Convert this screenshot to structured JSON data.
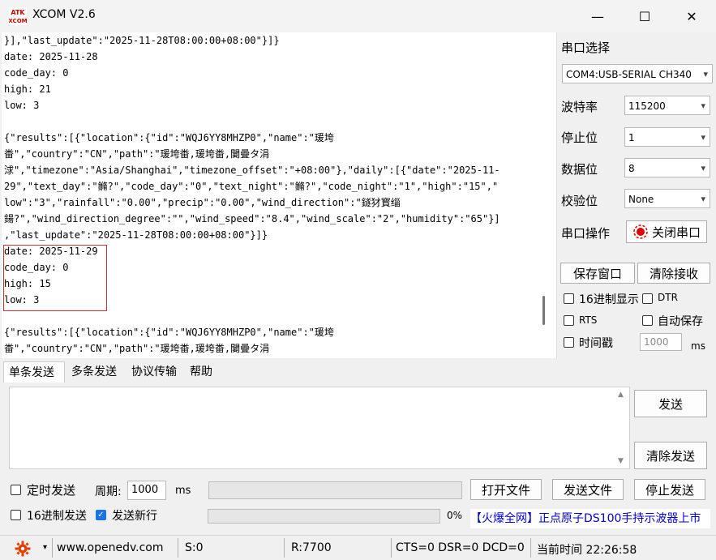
{
  "window": {
    "title": "XCOM V2.6",
    "minimize": "—",
    "maximize": "☐",
    "close": "✕"
  },
  "receive_lines": [
    "}],\"last_update\":\"2025-11-28T08:00:00+08:00\"}]}",
    "date: 2025-11-28",
    "code_day: 0",
    "high: 21",
    "low: 3",
    "",
    "{\"results\":[{\"location\":{\"id\":\"WQJ6YY8MHZP0\",\"name\":\"瑗垮",
    "畨\",\"country\":\"CN\",\"path\":\"瑗垮畨,瑗垮畨,闄曡タ涓",
    "浗\",\"timezone\":\"Asia/Shanghai\",\"timezone_offset\":\"+08:00\"},\"daily\":[{\"date\":\"2025-11-",
    "29\",\"text_day\":\"鏅?\",\"code_day\":\"0\",\"text_night\":\"鏅?\",\"code_night\":\"1\",\"high\":\"15\",\"",
    "low\":\"3\",\"rainfall\":\"0.00\",\"precip\":\"0.00\",\"wind_direction\":\"鐩犲寳缁",
    "鍚?\",\"wind_direction_degree\":\"\",\"wind_speed\":\"8.4\",\"wind_scale\":\"2\",\"humidity\":\"65\"}]",
    ",\"last_update\":\"2025-11-28T08:00:00+08:00\"}]}",
    "date: 2025-11-29",
    "code_day: 0",
    "high: 15",
    "low: 3",
    "",
    "{\"results\":[{\"location\":{\"id\":\"WQJ6YY8MHZP0\",\"name\":\"瑗垮",
    "畨\",\"country\":\"CN\",\"path\":\"瑗垮畨,瑗垮畨,闄曡タ涓"
  ],
  "panel": {
    "port_select_label": "串口选择",
    "port_value": "COM4:USB-SERIAL CH340",
    "baud_label": "波特率",
    "baud_value": "115200",
    "stop_label": "停止位",
    "stop_value": "1",
    "data_label": "数据位",
    "data_value": "8",
    "parity_label": "校验位",
    "parity_value": "None",
    "port_op_label": "串口操作",
    "close_port_btn": "关闭串口",
    "save_window_btn": "保存窗口",
    "clear_recv_btn": "清除接收",
    "hex_display": "16进制显示",
    "dtr": "DTR",
    "rts": "RTS",
    "auto_save": "自动保存",
    "timestamp": "时间戳",
    "timestamp_value": "1000",
    "timestamp_unit": "ms"
  },
  "tabs": [
    "单条发送",
    "多条发送",
    "协议传输",
    "帮助"
  ],
  "send": {
    "send_btn": "发送",
    "clear_send_btn": "清除发送",
    "timed_send": "定时发送",
    "period_label": "周期:",
    "period_value": "1000",
    "period_unit": "ms",
    "open_file_btn": "打开文件",
    "send_file_btn": "发送文件",
    "stop_send_btn": "停止发送",
    "hex_send": "16进制发送",
    "send_newline": "发送新行",
    "progress_text": "0%",
    "progress": 0
  },
  "ad_text": "【火爆全网】正点原子DS100手持示波器上市",
  "status": {
    "url": "www.openedv.com",
    "sent": "S:0",
    "received": "R:7700",
    "lines": "CTS=0 DSR=0 DCD=0",
    "time": "当前时间 22:26:58"
  },
  "colors": {
    "highlight_box": "#d03030",
    "gear_icon": "#e04000",
    "ad_text": "#0000d0"
  }
}
